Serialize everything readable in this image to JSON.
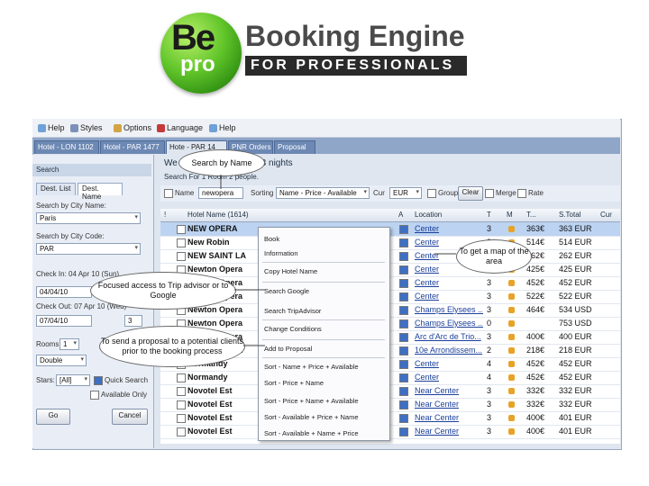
{
  "logo": {
    "be": "Be",
    "pro": "pro",
    "title": "Booking Engine",
    "subtitle": "FOR PROFESSIONALS"
  },
  "menubar": {
    "items": [
      "Help",
      "Styles",
      "Options",
      "Language",
      "Help"
    ]
  },
  "tabs": [
    "Hotel - LON 1102",
    "Hotel - PAR 1477",
    "Hote - PAR 14",
    "PNR Orders",
    "Proposal"
  ],
  "left": {
    "search_head": "Search",
    "subtabs": [
      "Dest. List",
      "Dest. Name"
    ],
    "city_name_label": "Search by City Name:",
    "city_name_value": "Paris",
    "city_code_label": "Search by City Code:",
    "city_code_value": "PAR",
    "checkin_label": "Check In: 04 Apr 10 (Sun)",
    "checkin_value": "04/04/10",
    "checkout_label": "Check Out: 07 Apr 10 (Wed)",
    "checkout_value": "07/04/10",
    "nights_value": "3",
    "rooms_label": "Rooms:",
    "rooms_value": "1",
    "room_type_value": "Double",
    "stars_label": "Stars:",
    "stars_value": "[All]",
    "quick_search": "Quick Search",
    "available_only": "Available Only",
    "go_label": "Go",
    "cancel_label": "Cancel"
  },
  "header": {
    "line1": "We                              on 04 APR 2010 for 3 nights",
    "line2": "Search For 1 Room 2 people."
  },
  "filterbar": {
    "name_label": "Name",
    "name_value": "newopera",
    "sorting_label": "Sorting",
    "sorting_value": "Name - Price - Available",
    "cur_label": "Cur",
    "cur_value": "EUR",
    "group_label": "Group",
    "clear_label": "Clear",
    "merge_label": "Merge",
    "rate_label": "Rate"
  },
  "table": {
    "headers": [
      "!",
      "Hotel Name (1614)",
      "A",
      "Location",
      "T",
      "M",
      "T...",
      "S.Total",
      "Cur"
    ],
    "rows": [
      {
        "name": "NEW OPERA",
        "location": "Center",
        "cat": "3",
        "total": "363€",
        "stotal": "363 EUR",
        "sel": true
      },
      {
        "name": "New Robin",
        "location": "Center",
        "cat": "3",
        "total": "514€",
        "stotal": "514 EUR"
      },
      {
        "name": "NEW SAINT LA",
        "location": "Center",
        "cat": "3",
        "total": "262€",
        "stotal": "262 EUR"
      },
      {
        "name": "Newton Opera",
        "location": "Center",
        "cat": "3",
        "total": "425€",
        "stotal": "425 EUR"
      },
      {
        "name": "Newton Opera",
        "location": "Center",
        "cat": "3",
        "total": "452€",
        "stotal": "452 EUR"
      },
      {
        "name": "Newton Opera",
        "location": "Center",
        "cat": "3",
        "total": "522€",
        "stotal": "522 EUR"
      },
      {
        "name": "Newton Opera",
        "location": "Champs Elysees ...",
        "cat": "3",
        "total": "464€",
        "stotal": "534 USD"
      },
      {
        "name": "Newton Opera",
        "location": "Champs Elysees ...",
        "cat": "0",
        "total": "",
        "stotal": "753 USD"
      },
      {
        "name": "Newton Opera",
        "location": "Arc d'Arc de Trio...",
        "cat": "3",
        "total": "400€",
        "stotal": "400 EUR"
      },
      {
        "name": "Newton Opera",
        "location": "10e Arrondissem...",
        "cat": "2",
        "total": "218€",
        "stotal": "218 EUR"
      },
      {
        "name": "Normandy",
        "location": "Center",
        "cat": "4",
        "total": "452€",
        "stotal": "452 EUR"
      },
      {
        "name": "Normandy",
        "location": "Center",
        "cat": "4",
        "total": "452€",
        "stotal": "452 EUR"
      },
      {
        "name": "Novotel Est",
        "location": "Near Center",
        "cat": "3",
        "total": "332€",
        "stotal": "332 EUR"
      },
      {
        "name": "Novotel Est",
        "location": "Near Center",
        "cat": "3",
        "total": "332€",
        "stotal": "332 EUR"
      },
      {
        "name": "Novotel Est",
        "location": "Near Center",
        "cat": "3",
        "total": "400€",
        "stotal": "401 EUR"
      },
      {
        "name": "Novotel Est",
        "location": "Near Center",
        "cat": "3",
        "total": "400€",
        "stotal": "401 EUR"
      }
    ]
  },
  "context_menu": {
    "items": [
      "Book",
      "Information",
      "Copy Hotel Name",
      "Search Google",
      "Search TripAdvisor",
      "Change Conditions",
      "Add to Proposal",
      "Sort - Name + Price + Available",
      "Sort - Price + Name",
      "Sort - Price + Name + Available",
      "Sort - Available + Price + Name",
      "Sort - Available + Name + Price"
    ]
  },
  "callouts": {
    "search_by_name": "Search by Name",
    "map": "To get a map of the area",
    "focused_access": "Focused access to Trip advisor or to Google",
    "proposal": "To send a proposal to a potential clients prior to the booking process"
  },
  "colors": {
    "accent": "#6d88b3",
    "logo_green": "#62c62a",
    "selected_row": "#bcd3f1"
  }
}
